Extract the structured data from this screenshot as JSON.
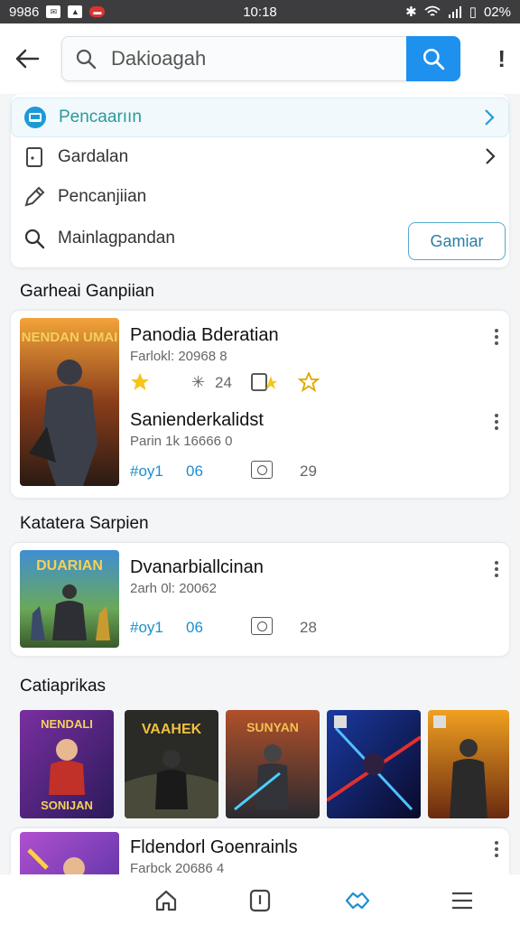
{
  "status_bar": {
    "left_text": "9986",
    "time": "10:18",
    "battery": "02%"
  },
  "search": {
    "value": "Dakioagah",
    "placeholder": "Dakioagah"
  },
  "menu": {
    "items": [
      {
        "label": "Pencaarıın",
        "icon": "game-console-icon",
        "active": true
      },
      {
        "label": "Gardalan",
        "icon": "document-icon"
      },
      {
        "label": "Pencanjiian",
        "icon": "pencil-icon"
      },
      {
        "label": "Mainlagpandan",
        "icon": "search-icon"
      }
    ],
    "action_button": "Gamiar"
  },
  "sections": {
    "s1_title": "Garheai Ganpiian",
    "s2_title": "Katatera Sarpien",
    "s3_title": "Catiaprikas"
  },
  "card1": {
    "thumb_text": "NENDAN UMAI",
    "e1_title": "Panodia Bderatian",
    "e1_sub": "Farlokl: 20968 8",
    "e1_rating": "24",
    "e2_title": "Sanienderkalidst",
    "e2_sub": "Parin 1k 16666 0",
    "e2_tag": "#oy1",
    "e2_num": "06",
    "e2_count": "29"
  },
  "card2": {
    "thumb_text": "DUARIAN",
    "title": "Dvanarbiallcinan",
    "sub": "2arh 0l: 20062",
    "tag": "#oy1",
    "num": "06",
    "count": "28"
  },
  "grid": [
    {
      "label": "NENDALI",
      "label2": "SONIJAN"
    },
    {
      "label": "VAAHEK"
    },
    {
      "label": "SUNYAN"
    },
    {
      "label": ""
    },
    {
      "label": ""
    }
  ],
  "card3": {
    "title": "Fldendorl Goenrainls",
    "sub": "Farbck 20686 4"
  },
  "colors": {
    "accent": "#1e90ee",
    "teal": "#2a9a9a",
    "tag_blue": "#1e8fcf"
  }
}
